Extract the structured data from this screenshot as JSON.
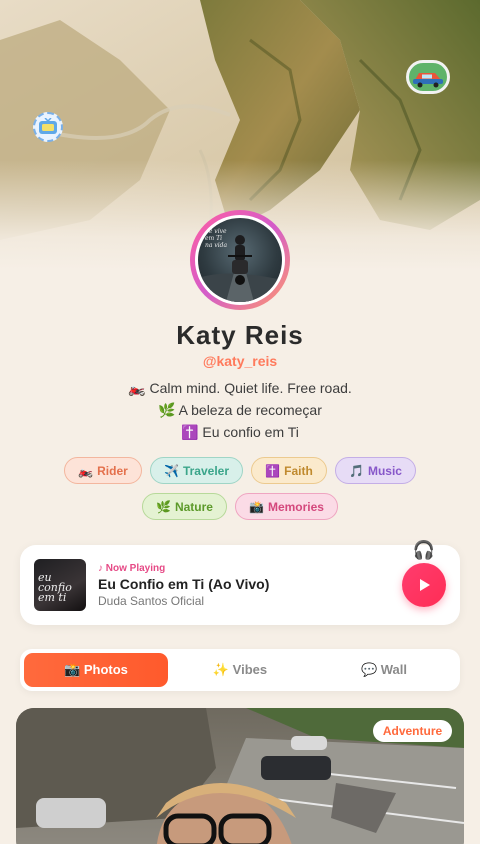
{
  "profile": {
    "name": "Katy Reis",
    "handle": "@katy_reis",
    "bio": [
      "🏍️ Calm mind. Quiet life. Free road.",
      "🌿 A beleza de recomeçar",
      "✝️ Eu confio em Ti"
    ]
  },
  "avatar": {
    "caption": [
      "be vive",
      "em Ti",
      "na vida"
    ]
  },
  "stickers": {
    "left_icon": "tv-icon",
    "right_icon": "car-icon"
  },
  "tags": [
    {
      "emoji": "🏍️",
      "label": "Rider"
    },
    {
      "emoji": "✈️",
      "label": "Traveler"
    },
    {
      "emoji": "✝️",
      "label": "Faith"
    },
    {
      "emoji": "🎵",
      "label": "Music"
    },
    {
      "emoji": "🌿",
      "label": "Nature"
    },
    {
      "emoji": "📸",
      "label": "Memories"
    }
  ],
  "now_playing": {
    "label": "♪ Now Playing",
    "title": "Eu Confio em Ti (Ao Vivo)",
    "artist": "Duda Santos Oficial",
    "album_text": "eu confio em ti",
    "decor_icon": "🎧"
  },
  "tabs": [
    {
      "label": "📸 Photos",
      "active": true
    },
    {
      "label": "✨ Vibes",
      "active": false
    },
    {
      "label": "💬 Wall",
      "active": false
    }
  ],
  "photo": {
    "badge": "Adventure"
  },
  "colors": {
    "accent": "#ff6a3d",
    "handle": "#ff7a5c",
    "play": "#ff2d55",
    "background": "#f6efe6"
  }
}
